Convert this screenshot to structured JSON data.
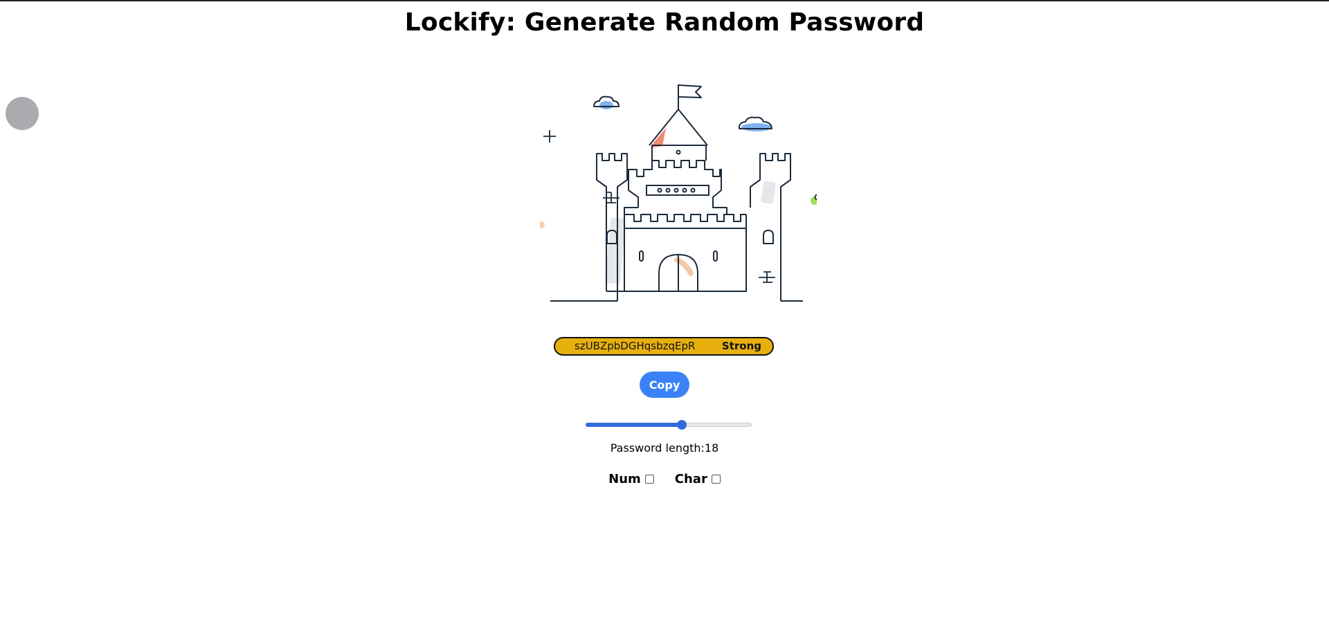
{
  "header": {
    "title": "Lockify: Generate Random Password"
  },
  "illustration": {
    "icon": "castle-illustration"
  },
  "password": {
    "value": "szUBZpbDGHqsbzqEpR",
    "strength": "Strong",
    "strength_color": "#e8b00f"
  },
  "actions": {
    "copy_label": "Copy",
    "copy_color": "#3b82f6"
  },
  "length": {
    "label": "Password length:",
    "value": "18",
    "slider_fraction": 0.58,
    "slider_color": "#2f6bde"
  },
  "options": {
    "num_label": "Num",
    "num_checked": false,
    "char_label": "Char",
    "char_checked": false
  }
}
